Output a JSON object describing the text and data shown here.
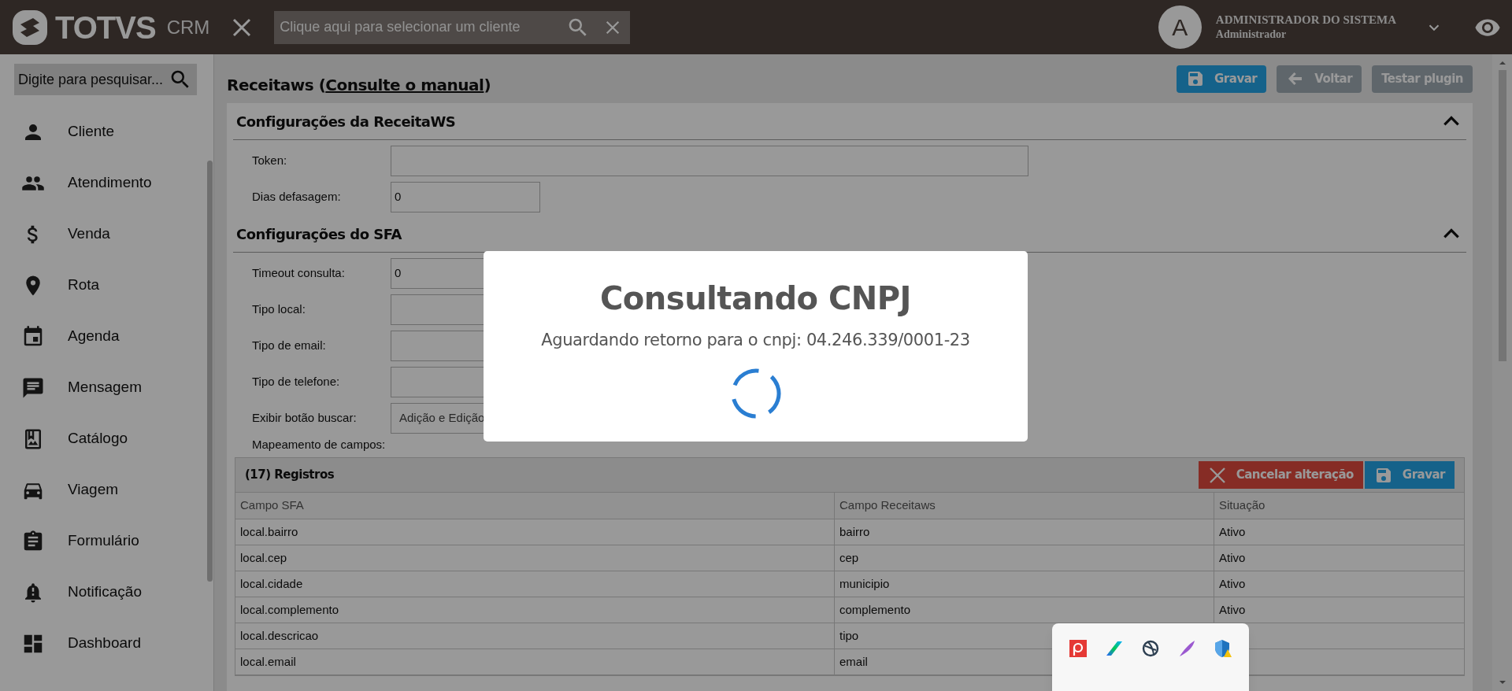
{
  "header": {
    "logo_text": "TOTVS",
    "logo_suffix": "CRM",
    "client_search": {
      "placeholder": "Clique aqui para selecionar um cliente"
    },
    "avatar_letter": "A",
    "user_name": "ADMINISTRADOR DO SISTEMA",
    "user_role": "Administrador"
  },
  "sidebar": {
    "search": {
      "placeholder": "Digite para pesquisar..."
    },
    "items": [
      {
        "label": "Cliente",
        "kind": "person"
      },
      {
        "label": "Atendimento",
        "kind": "people"
      },
      {
        "label": "Venda",
        "kind": "dollar"
      },
      {
        "label": "Rota",
        "kind": "pin"
      },
      {
        "label": "Agenda",
        "kind": "calendar"
      },
      {
        "label": "Mensagem",
        "kind": "message"
      },
      {
        "label": "Catálogo",
        "kind": "catalog"
      },
      {
        "label": "Viagem",
        "kind": "car"
      },
      {
        "label": "Formulário",
        "kind": "clipboard"
      },
      {
        "label": "Notificação",
        "kind": "bell"
      },
      {
        "label": "Dashboard",
        "kind": "dashboard"
      }
    ]
  },
  "page": {
    "title_prefix": "Receitaws (",
    "manual_link": "Consulte o manual",
    "title_suffix": ")",
    "buttons": [
      {
        "label": "Gravar",
        "kind": "save",
        "disabled": false
      },
      {
        "label": "Voltar",
        "kind": "back",
        "disabled": true
      },
      {
        "label": "Testar plugin",
        "kind": "plain",
        "disabled": true
      }
    ]
  },
  "sections": [
    {
      "title": "Configurações da ReceitaWS",
      "expanded": true,
      "fields": [
        {
          "label": "Token:",
          "kind": "wide"
        },
        {
          "label": "Dias defasagem:",
          "kind": "short",
          "value": "0"
        }
      ]
    },
    {
      "title": "Configurações do SFA",
      "expanded": true,
      "fields": [
        {
          "label": "Timeout consulta:",
          "kind": "medium",
          "value": "0"
        },
        {
          "label": "Tipo local:",
          "kind": "medium"
        },
        {
          "label": "Tipo de email:",
          "kind": "medium"
        },
        {
          "label": "Tipo de telefone:",
          "kind": "medium"
        },
        {
          "label": "Exibir botão buscar:",
          "kind": "select",
          "value": "Adição e Edição"
        }
      ]
    }
  ],
  "mapping": {
    "label": "Mapeamento de campos:",
    "title": "(17) Registros",
    "buttons": [
      {
        "label": "Cancelar alteração",
        "kind": "cancel"
      },
      {
        "label": "Gravar",
        "kind": "save"
      }
    ],
    "columns": [
      "Campo SFA",
      "Campo Receitaws",
      "Situação"
    ],
    "rows": [
      [
        "local.bairro",
        "bairro",
        "Ativo"
      ],
      [
        "local.cep",
        "cep",
        "Ativo"
      ],
      [
        "local.cidade",
        "municipio",
        "Ativo"
      ],
      [
        "local.complemento",
        "complemento",
        "Ativo"
      ],
      [
        "local.descricao",
        "tipo",
        ""
      ],
      [
        "local.email",
        "email",
        ""
      ]
    ]
  },
  "modal": {
    "title": "Consultando CNPJ",
    "message": "Aguardando retorno para o cnpj: 04.246.339/0001-23"
  }
}
